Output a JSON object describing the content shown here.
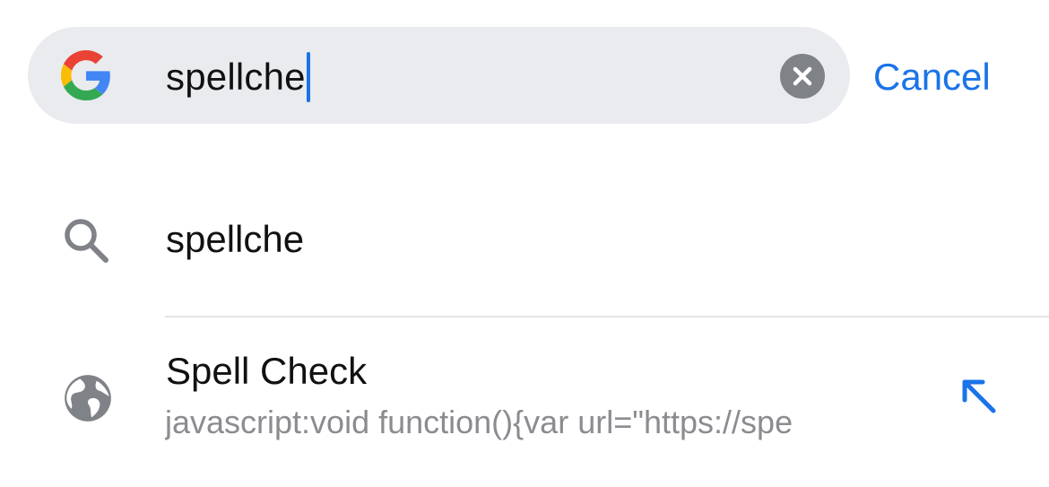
{
  "search": {
    "value": "spellche",
    "clear_icon": "clear-circle-icon",
    "logo_icon": "google-g-icon"
  },
  "cancel_label": "Cancel",
  "suggestions": [
    {
      "icon": "search-icon",
      "text": "spellche"
    },
    {
      "icon": "globe-icon",
      "title": "Spell Check",
      "url": "javascript:void function(){var url=\"https://spe",
      "action_icon": "append-arrow-icon"
    }
  ],
  "colors": {
    "accent": "#1a73e8",
    "search_bg": "#e9ebee",
    "icon_gray": "#7f8287",
    "url_gray": "#8a8c90"
  }
}
